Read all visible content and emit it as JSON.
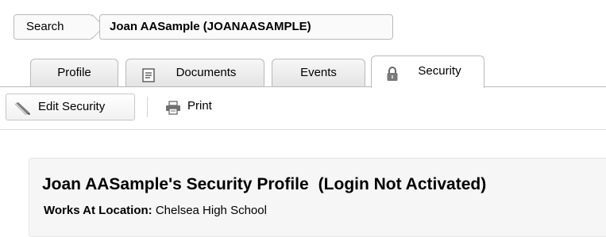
{
  "breadcrumb": {
    "search_label": "Search",
    "current_label": "Joan AASample (JOANAASAMPLE)"
  },
  "tabs": [
    {
      "label": "Profile",
      "icon": "none"
    },
    {
      "label": "Documents",
      "icon": "document-icon"
    },
    {
      "label": "Events",
      "icon": "none"
    },
    {
      "label": "Security",
      "icon": "lock-icon",
      "active": true
    }
  ],
  "toolbar": {
    "edit_label": "Edit Security",
    "print_label": "Print"
  },
  "profile": {
    "title": "Joan AASample's Security Profile",
    "status": "(Login Not Activated)",
    "location_label": "Works At Location:",
    "location_value": "Chelsea High School"
  },
  "colors": {
    "border": "#b9b9b9",
    "tab_gradient_top": "#f7f7f7",
    "tab_gradient_bottom": "#e4e4e4",
    "panel_bg": "#f6f6f6"
  }
}
